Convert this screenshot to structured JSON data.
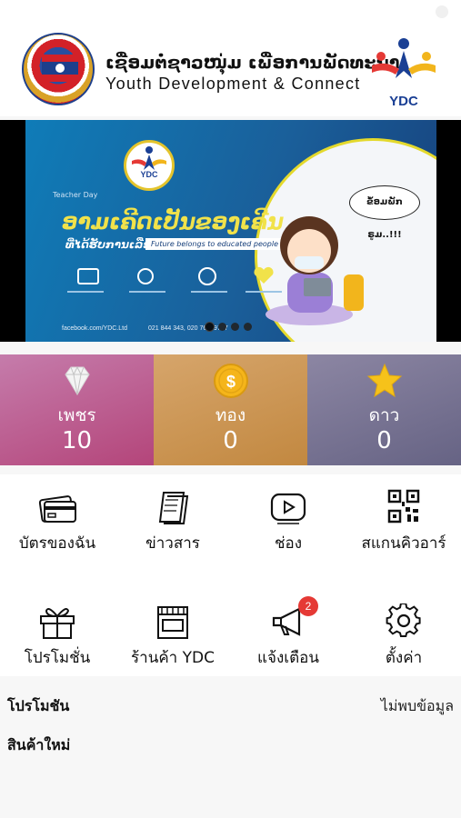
{
  "header": {
    "title_lao": "ເຊື່ອມຕໍ່ຊາວໜຸ່ມ ເພື່ອການພັດທະນາ",
    "title_en": "Youth Development & Connect",
    "logo_text": "YDC",
    "emblem_text": "ຄະຊປປ"
  },
  "banner": {
    "logo_text": "YDC",
    "headline": "ອາມເຄີດເປັນຂອງເຄີນ",
    "subline": "ທີ່ໄດ້ຮັບການເລືອກ",
    "tag": "Future belongs to educated people",
    "bubble": "ຂໍ້ອມພັກຣູມ..!!!",
    "corner_text": "Teacher Day",
    "footer_fb": "facebook.com/YDC.Ltd",
    "footer_phone": "021 844 343, 020 76689777",
    "slides": 4,
    "active_slide": 0
  },
  "points": [
    {
      "label": "เพชร",
      "value": "10",
      "icon": "diamond-icon"
    },
    {
      "label": "ทอง",
      "value": "0",
      "icon": "gold-coin-icon"
    },
    {
      "label": "ดาว",
      "value": "0",
      "icon": "star-icon"
    }
  ],
  "menu": [
    {
      "label": "บัตรของฉัน",
      "icon": "card-icon"
    },
    {
      "label": "ข่าวสาร",
      "icon": "news-icon"
    },
    {
      "label": "ช่อง",
      "icon": "channel-play-icon"
    },
    {
      "label": "สแกนคิวอาร์",
      "icon": "qr-code-icon"
    },
    {
      "label": "โปรโมชั่น",
      "icon": "gift-icon"
    },
    {
      "label": "ร้านค้า YDC",
      "icon": "store-icon"
    },
    {
      "label": "แจ้งเตือน",
      "icon": "megaphone-icon",
      "badge": "2"
    },
    {
      "label": "ตั้งค่า",
      "icon": "gear-icon"
    }
  ],
  "sections": {
    "promotion_title": "โปรโมชัน",
    "promotion_empty": "ไม่พบข้อมูล",
    "new_products_title": "สินค้าใหม่"
  },
  "colors": {
    "diamond_card": "#b4457a",
    "gold_card": "#c28840",
    "star_card": "#666384",
    "badge": "#e53935"
  }
}
